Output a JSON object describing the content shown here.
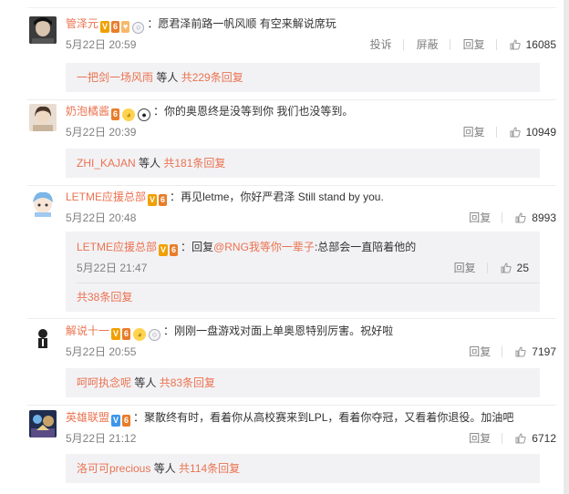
{
  "comments": [
    {
      "user": "管泽元",
      "text": "愿君泽前路一帆风顺 有空来解说席玩",
      "time": "5月22日 20:59",
      "actions": [
        "投诉",
        "屏蔽",
        "回复"
      ],
      "likes": "16085",
      "summary": {
        "user": "一把剑一场风雨",
        "middle": " 等人 ",
        "count": "共229条回复"
      },
      "avatar_color": "#3a3a3a"
    },
    {
      "user": "奶泡橘酱",
      "text": "你的奥恩终是没等到你 我们也没等到。",
      "time": "5月22日 20:39",
      "reply_label": "回复",
      "likes": "10949",
      "summary": {
        "user": "ZHI_KAJAN",
        "middle": " 等人 ",
        "count": "共181条回复"
      },
      "avatar_color": "#cbb59a"
    },
    {
      "user": "LETME应援总部",
      "text": "再见letme，你好严君泽 Still stand by you.",
      "time": "5月22日 20:48",
      "reply_label": "回复",
      "likes": "8993",
      "avatar_color": "#b7d4ef",
      "sub_reply": {
        "user": "LETME应援总部",
        "prefix": "回复",
        "mention": "@RNG我等你一辈子",
        "text": ":总部会一直陪着他的",
        "time": "5月22日 21:47",
        "reply_label": "回复",
        "likes": "25",
        "more": "共38条回复"
      }
    },
    {
      "user": "解说十一",
      "text": "刚刚一盘游戏对面上单奥恩特别厉害。祝好啦",
      "time": "5月22日 20:55",
      "reply_label": "回复",
      "likes": "7197",
      "summary": {
        "user": "呵呵执念呢",
        "middle": " 等人 ",
        "count": "共83条回复"
      },
      "avatar_color": "#222222"
    },
    {
      "user": "英雄联盟",
      "text": "聚散终有时，看着你从高校赛来到LPL，看着你夺冠，又看着你退役。加油吧",
      "time": "5月22日 21:12",
      "reply_label": "回复",
      "likes": "6712",
      "summary": {
        "user": "洛可可precious",
        "middle": " 等人 ",
        "count": "共114条回复"
      },
      "avatar_color": "#2c3e66"
    }
  ],
  "colors": {
    "accent": "#eb7350",
    "meta": "#808080",
    "box": "#f2f2f5"
  }
}
